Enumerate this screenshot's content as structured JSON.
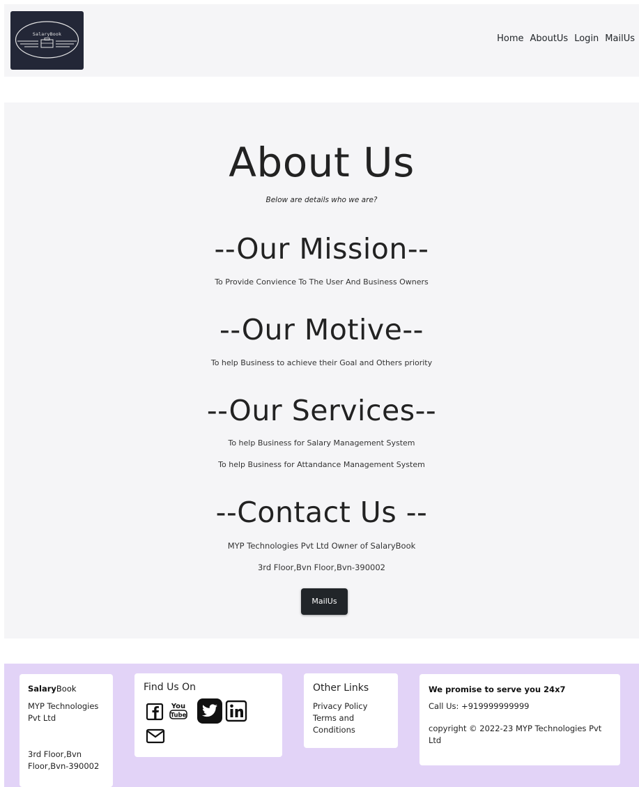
{
  "header": {
    "logo_text": "SalaryBook",
    "nav": [
      "Home",
      "AboutUs",
      "Login",
      "MailUs"
    ]
  },
  "main": {
    "title": "About Us",
    "subtitle": "Below are details who we are?",
    "mission_heading": "--Our Mission--",
    "mission_text": "To Provide Convience To The User And Business Owners",
    "motive_heading": "--Our Motive--",
    "motive_text": "To help Business to achieve their Goal and Others priority",
    "services_heading": "--Our Services--",
    "services": [
      "To help Business for Salary Management System",
      "To help Business for Attandance Management System"
    ],
    "contact_heading": "--Contact Us --",
    "contact_owner": "MYP Technologies Pvt Ltd Owner of SalaryBook",
    "contact_address": "3rd Floor,Bvn Floor,Bvn-390002",
    "mail_button": "MailUs"
  },
  "footer": {
    "brand_bold": "Salary",
    "brand_rest": "Book",
    "company": "MYP Technologies Pvt Ltd",
    "address": "3rd Floor,Bvn Floor,Bvn-390002",
    "find_us_title": "Find Us On",
    "social_icons": [
      "facebook-icon",
      "youtube-icon",
      "twitter-icon",
      "linkedin-icon",
      "mail-icon"
    ],
    "other_links_title": "Other Links",
    "other_links": [
      "Privacy Policy",
      "Terms and Conditions"
    ],
    "promise": "We promise to serve you 24x7",
    "call": "Call Us: +919999999999",
    "copyright": "copyright © 2022-23 MYP Technologies Pvt Ltd"
  },
  "colors": {
    "header_bg": "#f5f5f7",
    "footer_bg": "#e2d3f7",
    "logo_bg": "#232737",
    "button_bg": "#212529"
  }
}
